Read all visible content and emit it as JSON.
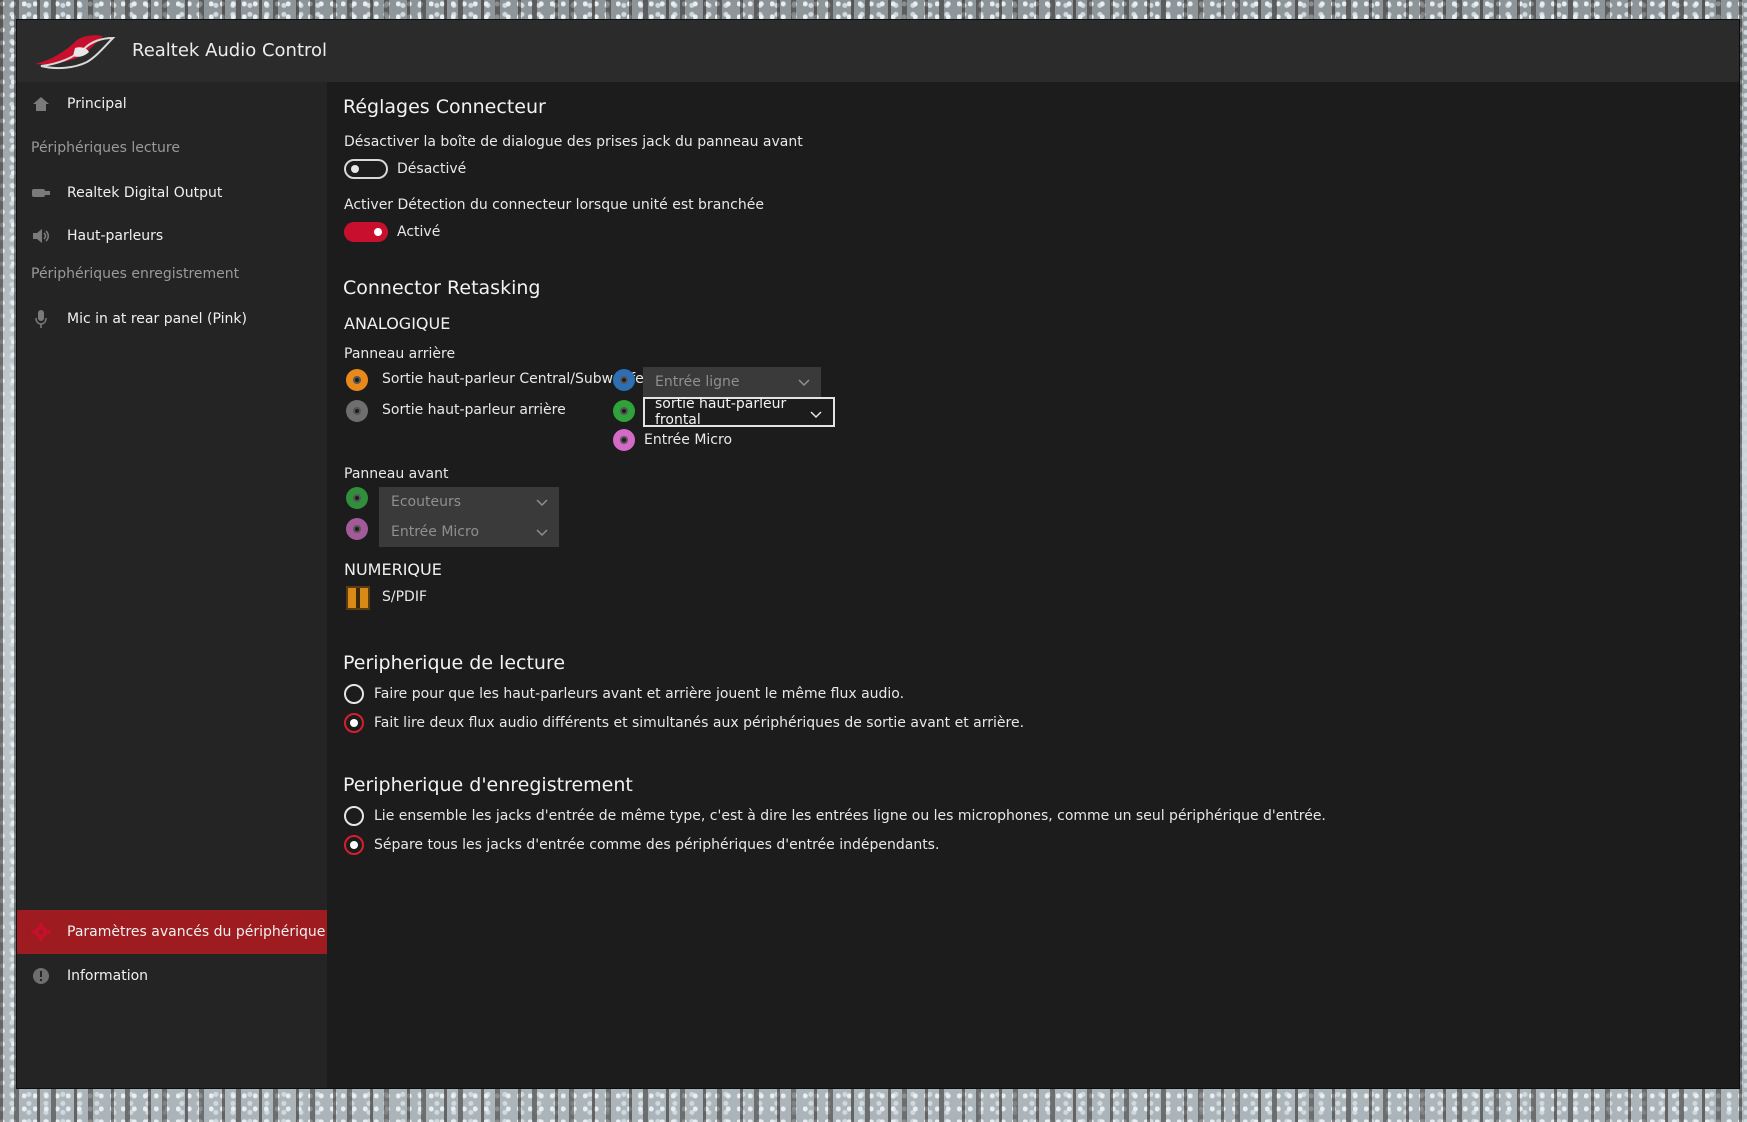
{
  "window": {
    "title": "Realtek Audio Control"
  },
  "sidebar": {
    "items": [
      {
        "label": "Principal",
        "icon": "home-icon"
      },
      {
        "label": "Realtek Digital Output",
        "icon": "digital-output-icon"
      },
      {
        "label": "Haut-parleurs",
        "icon": "speaker-icon"
      },
      {
        "label": "Mic in at rear panel (Pink)",
        "icon": "microphone-icon"
      }
    ],
    "sections": {
      "playback": "Périphériques lecture",
      "recording": "Périphériques enregistrement"
    },
    "bottom": {
      "advanced": "Paramètres avancés du périphérique",
      "info": "Information"
    }
  },
  "connector_settings": {
    "title": "Réglages Connecteur",
    "jack_dialog_label": "Désactiver la boîte de dialogue des prises jack du panneau avant",
    "jack_dialog_state": "Désactivé",
    "detection_label": "Activer Détection du connecteur lorsque unité est branchée",
    "detection_state": "Activé"
  },
  "retasking": {
    "title": "Connector Retasking",
    "analog_label": "ANALOGIQUE",
    "rear_panel_label": "Panneau arrière",
    "rear_left": [
      {
        "label": "Sortie haut-parleur Central/Subwoofer",
        "color": "#e8891c"
      },
      {
        "label": "Sortie haut-parleur arrière",
        "color": "#6e6e6e"
      }
    ],
    "rear_right": [
      {
        "value": "Entrée ligne",
        "color": "#2e6fb3"
      },
      {
        "value": "sortie haut-parleur frontal",
        "color": "#2fa33a"
      },
      {
        "value": "Entrée Micro",
        "color": "#d46ac8"
      }
    ],
    "front_panel_label": "Panneau avant",
    "front": [
      {
        "value": "Ecouteurs",
        "color": "#2f8f3a"
      },
      {
        "value": "Entrée Micro",
        "color": "#a35a99"
      }
    ],
    "digital_label": "NUMERIQUE",
    "spdif_label": "S/PDIF"
  },
  "playback_device": {
    "title": "Peripherique de lecture",
    "options": [
      "Faire pour que les haut-parleurs avant et arrière jouent le même flux audio.",
      "Fait lire deux flux audio différents et simultanés aux périphériques de sortie avant et arrière."
    ],
    "selected": 1
  },
  "recording_device": {
    "title": "Peripherique d'enregistrement",
    "options": [
      "Lie ensemble les jacks d'entrée de même type, c'est à dire les entrées ligne ou les microphones, comme un seul périphérique d'entrée.",
      "Sépare tous les jacks d'entrée comme des périphériques d'entrée indépendants."
    ],
    "selected": 1
  },
  "colors": {
    "accent": "#c8102e",
    "active_nav": "#9e1c1f"
  }
}
